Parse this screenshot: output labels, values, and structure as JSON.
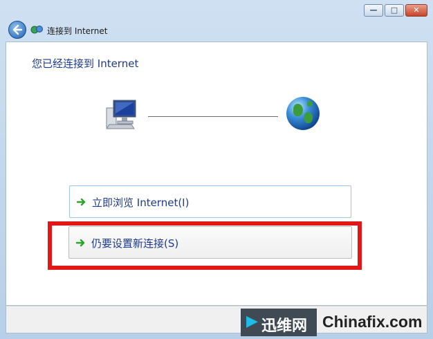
{
  "window": {
    "title": "连接到 Internet",
    "buttons": {
      "minimize": "—",
      "maximize": "□",
      "close": "✕"
    }
  },
  "main": {
    "heading": "您已经连接到 Internet",
    "options": [
      {
        "label": "立即浏览 Internet(I)",
        "icon": "green-arrow-icon"
      },
      {
        "label": "仍要设置新连接(S)",
        "icon": "green-arrow-icon"
      }
    ]
  },
  "watermark": {
    "brand_cn": "迅维网",
    "brand_en": "Chinafix.com"
  },
  "colors": {
    "accent_red": "#e01818",
    "link_blue": "#1e3a8a",
    "arrow_green": "#2aa32a"
  }
}
